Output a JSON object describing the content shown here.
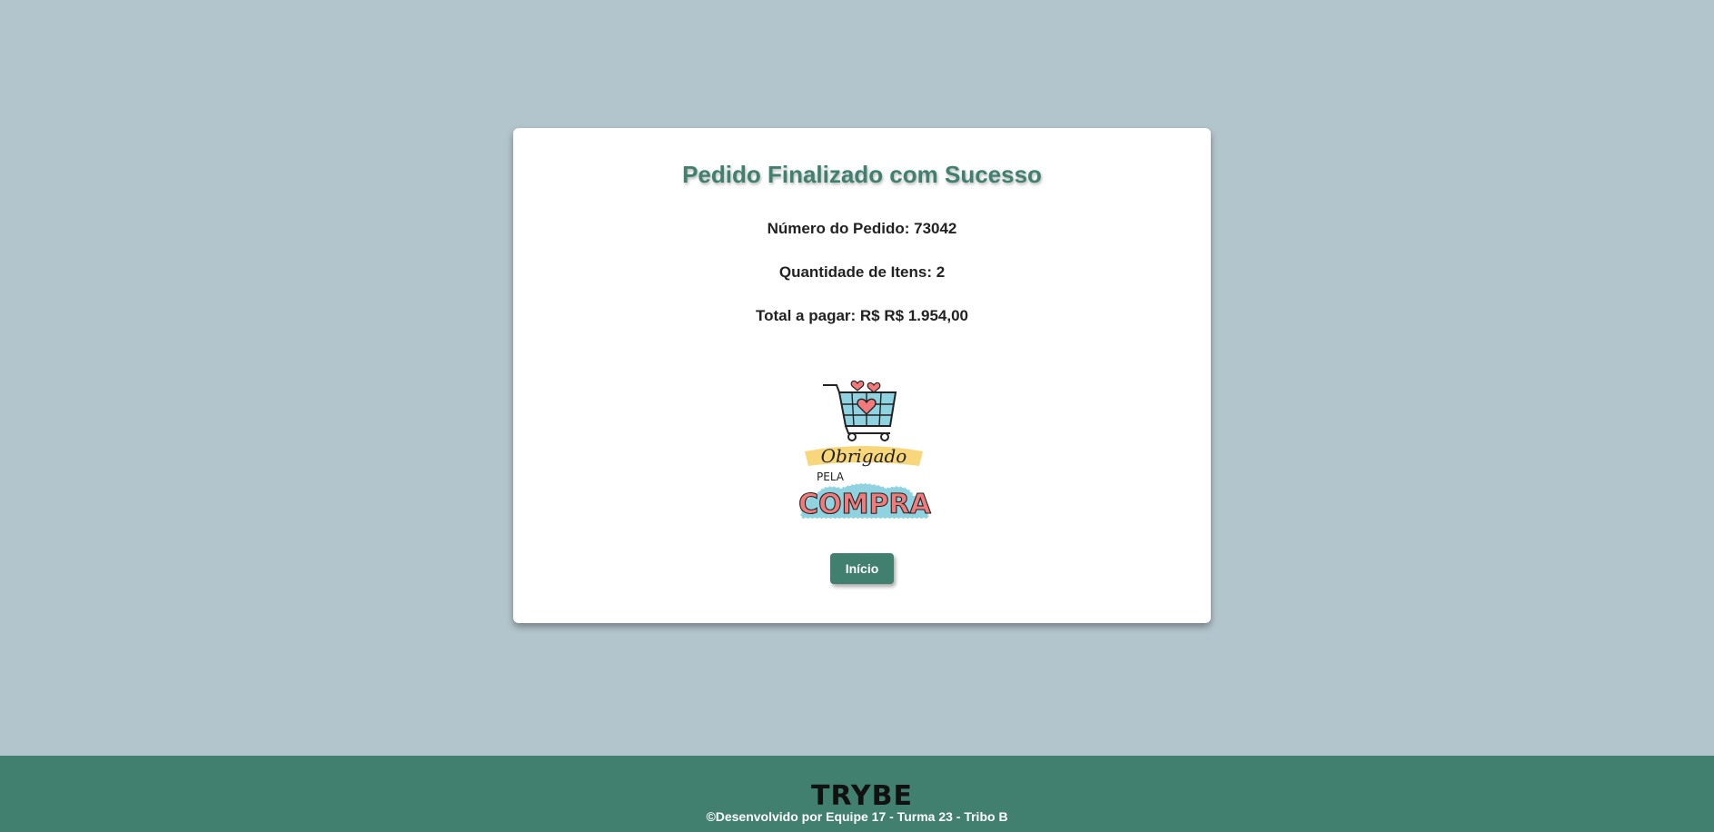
{
  "order": {
    "title": "Pedido Finalizado com Sucesso",
    "order_number": "Número do Pedido: 73042",
    "item_count": "Quantidade de Itens: 2",
    "total": "Total a pagar: R$ R$ 1.954,00"
  },
  "thank_you_image": {
    "line1": "Obrigado",
    "line2": "PELA",
    "line3": "COMPRA"
  },
  "actions": {
    "home_label": "Início"
  },
  "footer": {
    "brand": "TRYBE",
    "credit": "©Desenvolvido por Equipe 17 - Turma 23 - Tribo B"
  },
  "colors": {
    "background": "#b3c5cc",
    "accent": "#41806f",
    "card": "#ffffff"
  }
}
